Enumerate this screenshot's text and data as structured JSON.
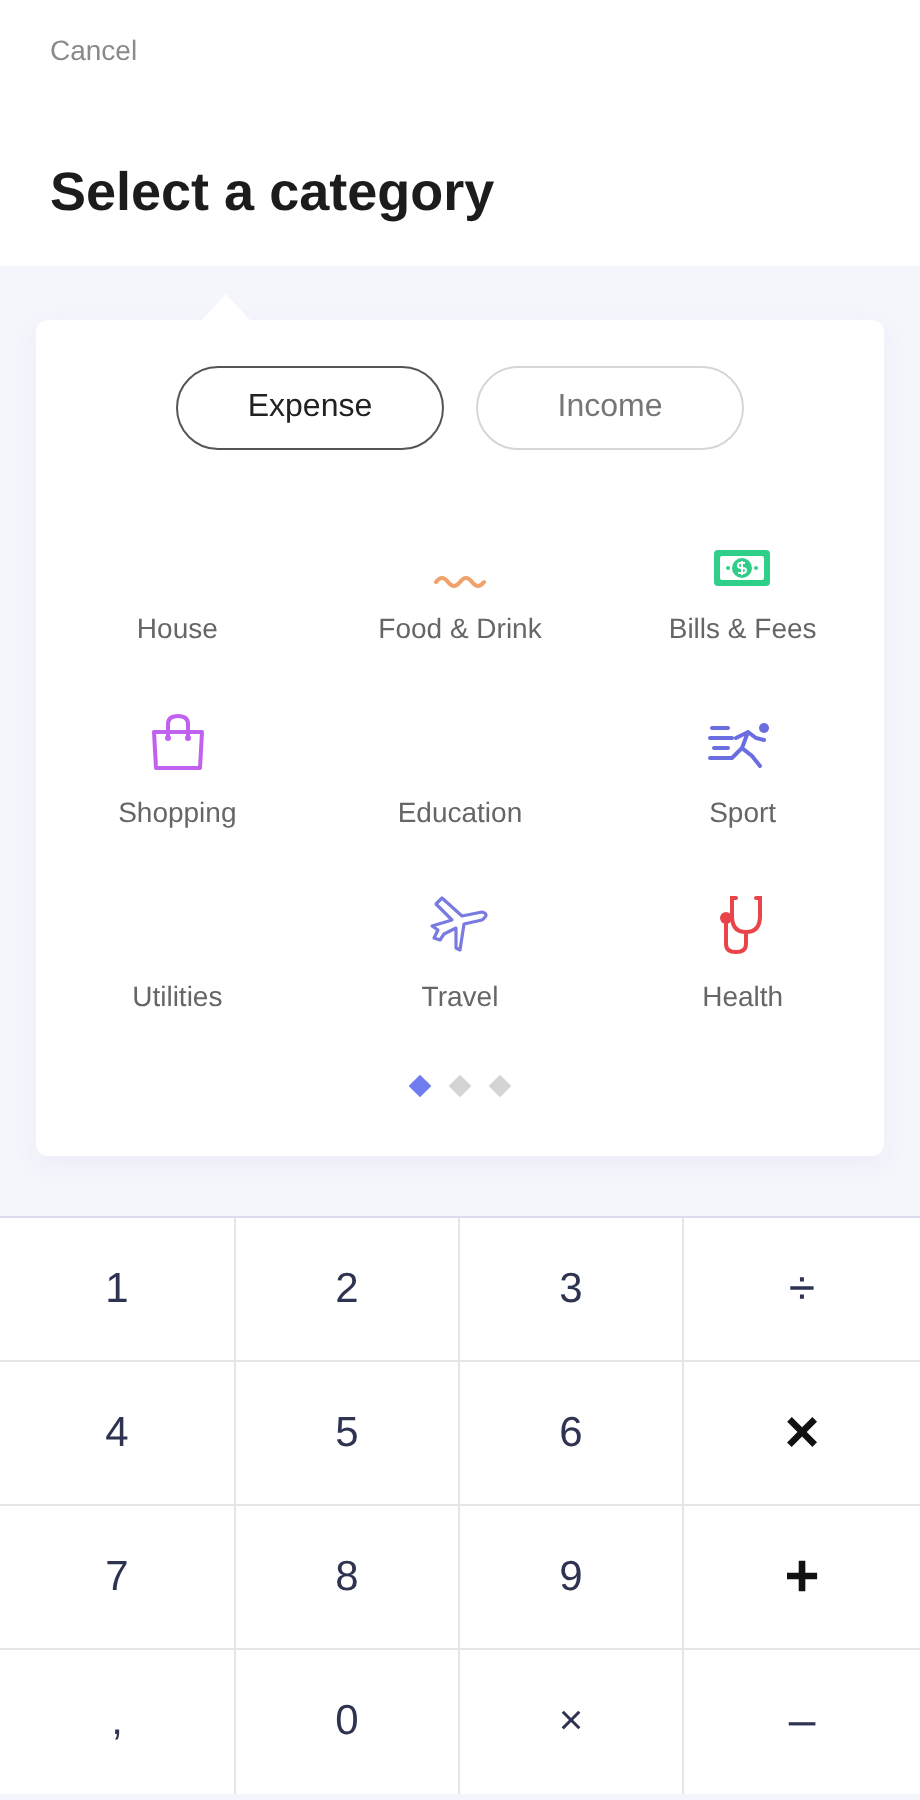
{
  "header": {
    "cancel": "Cancel",
    "title": "Select a category"
  },
  "tabs": [
    {
      "label": "Expense",
      "selected": true
    },
    {
      "label": "Income",
      "selected": false
    }
  ],
  "categories": [
    {
      "label": "House",
      "kind": "none"
    },
    {
      "label": "Food & Drink",
      "kind": "food"
    },
    {
      "label": "Bills & Fees",
      "kind": "money"
    },
    {
      "label": "Shopping",
      "kind": "bag"
    },
    {
      "label": "Education",
      "kind": "none"
    },
    {
      "label": "Sport",
      "kind": "runner"
    },
    {
      "label": "Utilities",
      "kind": "none"
    },
    {
      "label": "Travel",
      "kind": "plane"
    },
    {
      "label": "Health",
      "kind": "stethoscope"
    }
  ],
  "pages": [
    {
      "selected": true
    },
    {
      "selected": false
    },
    {
      "selected": false
    }
  ],
  "keypad": [
    {
      "label": "1",
      "kind": "digit"
    },
    {
      "label": "2",
      "kind": "digit"
    },
    {
      "label": "3",
      "kind": "digit"
    },
    {
      "label": "÷",
      "kind": "light"
    },
    {
      "label": "4",
      "kind": "digit"
    },
    {
      "label": "5",
      "kind": "digit"
    },
    {
      "label": "6",
      "kind": "digit"
    },
    {
      "label": "×",
      "kind": "heavy"
    },
    {
      "label": "7",
      "kind": "digit"
    },
    {
      "label": "8",
      "kind": "digit"
    },
    {
      "label": "9",
      "kind": "digit"
    },
    {
      "label": "+",
      "kind": "heavy"
    },
    {
      "label": ",",
      "kind": "digit"
    },
    {
      "label": "0",
      "kind": "digit"
    },
    {
      "label": "×",
      "kind": "digit"
    },
    {
      "label": "–",
      "kind": "light"
    }
  ]
}
